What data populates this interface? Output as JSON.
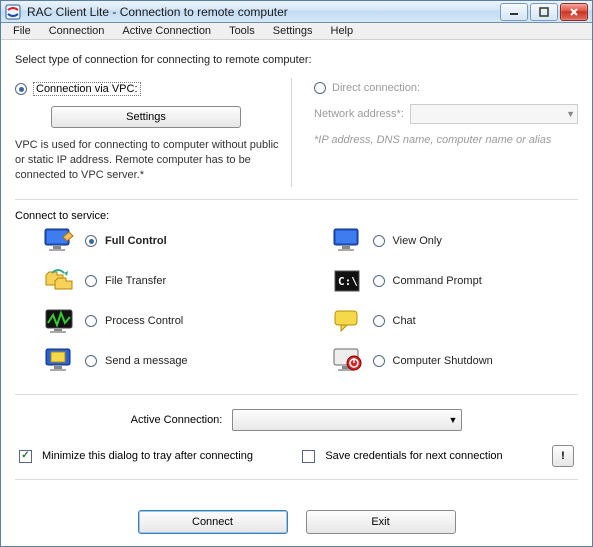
{
  "window": {
    "title": "RAC Client Lite - Connection to remote computer"
  },
  "menu": [
    "File",
    "Connection",
    "Active Connection",
    "Tools",
    "Settings",
    "Help"
  ],
  "instruction": "Select type of connection for connecting to remote computer:",
  "conn": {
    "vpc": {
      "label": "Connection via VPC:",
      "settings": "Settings",
      "note": "VPC is used for connecting to computer without public or static IP address. Remote computer has to be connected to VPC server.*"
    },
    "direct": {
      "label": "Direct connection:",
      "net_label": "Network address*:",
      "hint": "*IP address, DNS name, computer name or alias"
    }
  },
  "services_label": "Connect to service:",
  "services": {
    "full_control": "Full Control",
    "view_only": "View Only",
    "file_transfer": "File Transfer",
    "command_prompt": "Command Prompt",
    "process_control": "Process Control",
    "chat": "Chat",
    "send_message": "Send a message",
    "shutdown": "Computer Shutdown"
  },
  "active_connection_label": "Active Connection:",
  "options": {
    "minimize": "Minimize this dialog to tray after connecting",
    "save_creds": "Save credentials for next connection"
  },
  "buttons": {
    "connect": "Connect",
    "exit": "Exit"
  }
}
